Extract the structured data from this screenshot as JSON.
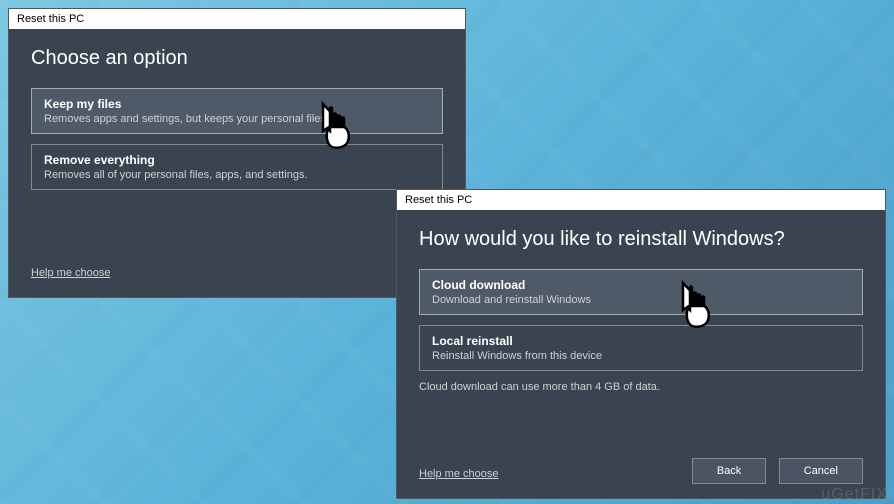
{
  "dialog1": {
    "title": "Reset this PC",
    "heading": "Choose an option",
    "options": [
      {
        "title": "Keep my files",
        "desc": "Removes apps and settings, but keeps your personal files."
      },
      {
        "title": "Remove everything",
        "desc": "Removes all of your personal files, apps, and settings."
      }
    ],
    "help": "Help me choose"
  },
  "dialog2": {
    "title": "Reset this PC",
    "heading": "How would you like to reinstall Windows?",
    "options": [
      {
        "title": "Cloud download",
        "desc": "Download and reinstall Windows"
      },
      {
        "title": "Local reinstall",
        "desc": "Reinstall Windows from this device"
      }
    ],
    "info": "Cloud download can use more than 4 GB of data.",
    "help": "Help me choose",
    "back": "Back",
    "cancel": "Cancel"
  },
  "watermark": "uGetFIX"
}
